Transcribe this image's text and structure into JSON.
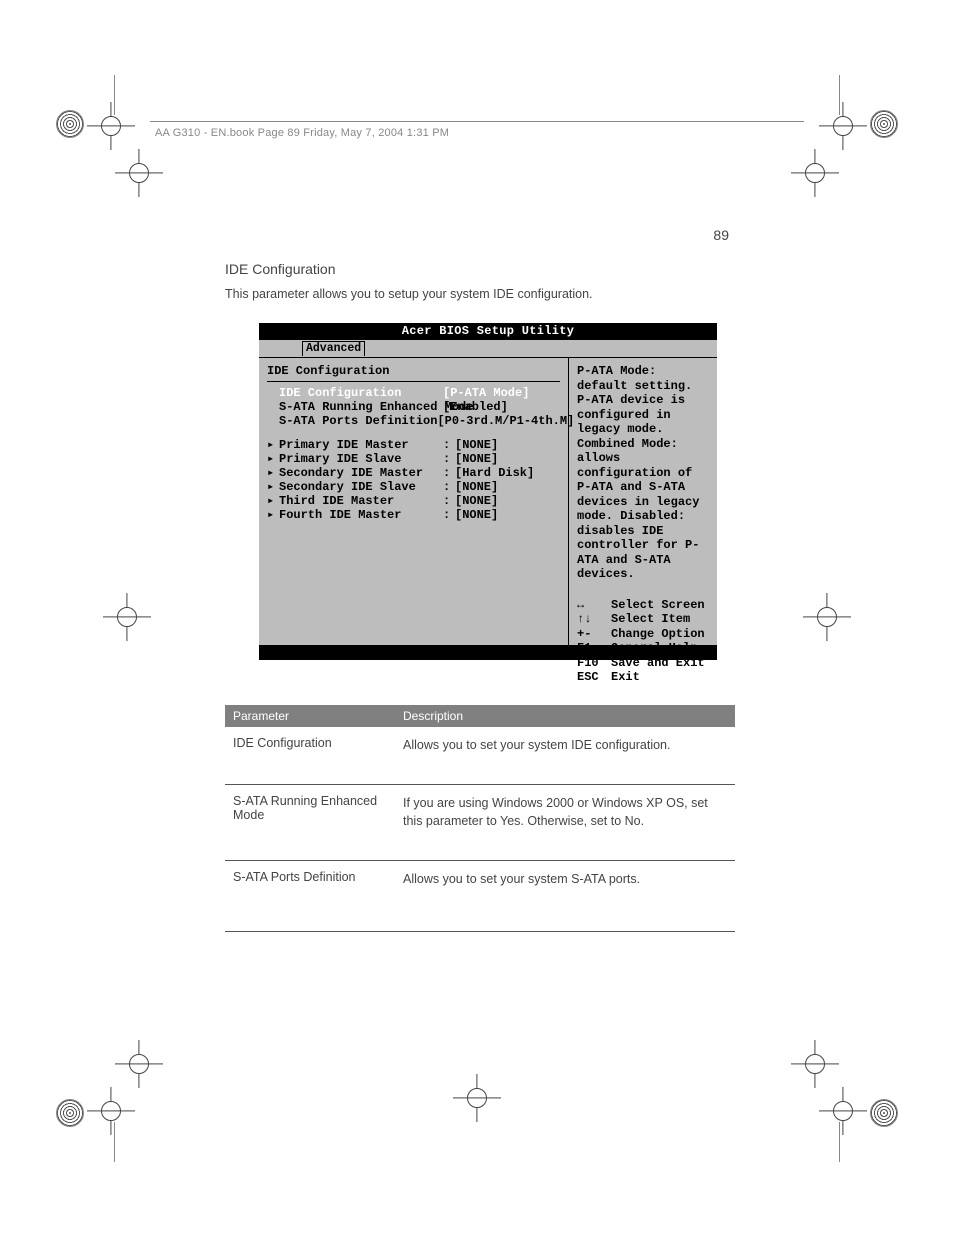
{
  "print_header": "AA G310 - EN.book  Page 89  Friday, May 7, 2004  1:31 PM",
  "page_number": "89",
  "section": {
    "title": "IDE Configuration",
    "desc": "This parameter allows you to setup your system IDE configuration."
  },
  "bios": {
    "title": "Acer BIOS Setup Utility",
    "tab": "Advanced",
    "heading": "IDE Configuration",
    "config": [
      {
        "label": "IDE Configuration",
        "value": "[P-ATA Mode]",
        "indent": true,
        "selected": true
      },
      {
        "label": "S-ATA Running Enhanced Mode",
        "value": "[Enabled]",
        "indent": true
      },
      {
        "label": "S-ATA Ports Definition",
        "value": "[P0-3rd.M/P1-4th.M]",
        "indent": true
      }
    ],
    "devices": [
      {
        "label": "Primary IDE Master",
        "value": "[NONE]"
      },
      {
        "label": "Primary IDE Slave",
        "value": "[NONE]"
      },
      {
        "label": "Secondary IDE Master",
        "value": "[Hard Disk]"
      },
      {
        "label": "Secondary IDE Slave",
        "value": "[NONE]"
      },
      {
        "label": "Third IDE Master",
        "value": "[NONE]"
      },
      {
        "label": "Fourth IDE Master",
        "value": "[NONE]"
      }
    ],
    "help": "P-ATA Mode: default setting. P-ATA device is configured in legacy mode. Combined Mode: allows configuration of P-ATA and S-ATA devices in legacy mode. Disabled: disables IDE controller for P-ATA and S-ATA devices.",
    "nav": [
      {
        "key": "↔",
        "action": "Select Screen"
      },
      {
        "key": "↑↓",
        "action": "Select Item"
      },
      {
        "key": "+-",
        "action": "Change Option"
      },
      {
        "key": "F1",
        "action": "General Help"
      },
      {
        "key": "F10",
        "action": "Save and Exit"
      },
      {
        "key": "ESC",
        "action": "Exit"
      }
    ]
  },
  "table": {
    "head": {
      "c1": "Parameter",
      "c2": "Description"
    },
    "rows": [
      {
        "c1": "IDE Configuration",
        "c2": "Allows you to set your system IDE configuration."
      },
      {
        "c1": "S-ATA Running Enhanced Mode",
        "c2": "If you are using Windows 2000 or Windows XP OS, set this parameter to Yes. Otherwise, set to No."
      },
      {
        "c1": "S-ATA Ports Definition",
        "c2": "Allows you to set your system S-ATA ports."
      }
    ]
  }
}
